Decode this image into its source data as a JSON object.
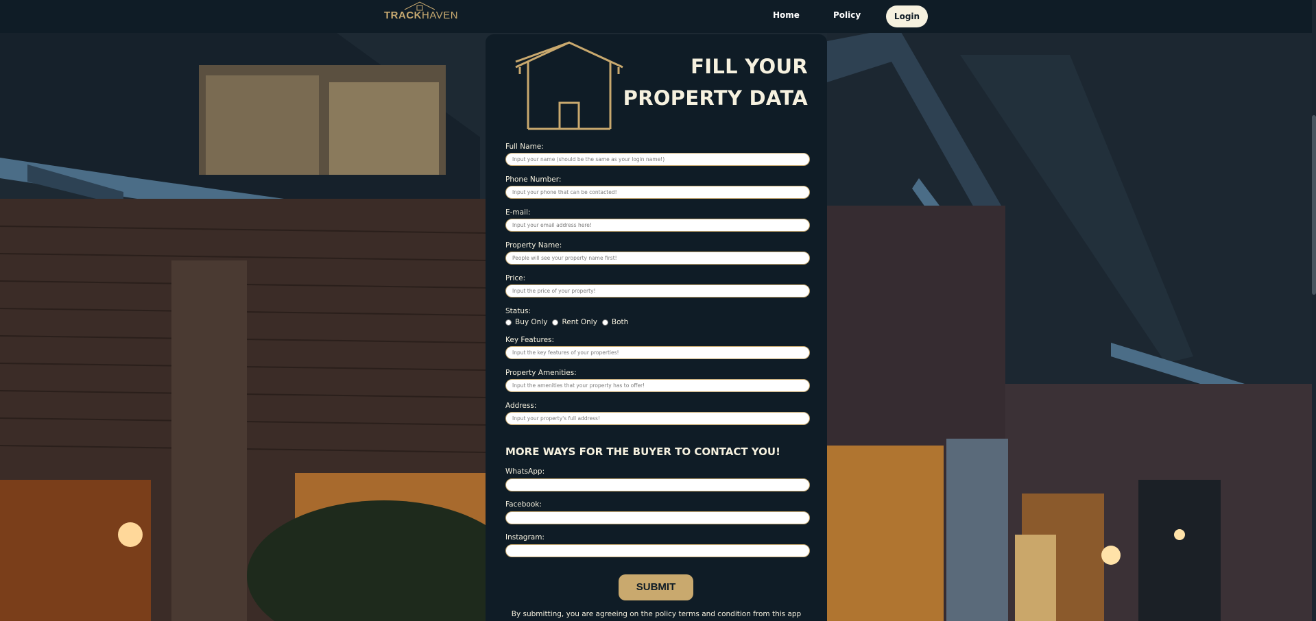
{
  "navbar": {
    "logo_main_light": "TRACK",
    "logo_main_bold": "HAVEN",
    "home": "Home",
    "policy": "Policy",
    "login": "Login"
  },
  "form": {
    "title_line1": "FILL YOUR",
    "title_line2": "PROPERTY DATA",
    "fields": {
      "full_name": {
        "label": "Full Name:",
        "placeholder": "Input your name (should be the same as your login name!)"
      },
      "phone": {
        "label": "Phone Number:",
        "placeholder": "Input your phone that can be contacted!"
      },
      "email": {
        "label": "E-mail:",
        "placeholder": "Input your email address here!"
      },
      "property_name": {
        "label": "Property Name:",
        "placeholder": "People will see your property name first!"
      },
      "price": {
        "label": "Price:",
        "placeholder": "Input the price of your property!"
      },
      "key_features": {
        "label": "Key Features:",
        "placeholder": "Input the key features of your properties!"
      },
      "amenities": {
        "label": "Property Amenities:",
        "placeholder": "Input the amenities that your property has to offer!"
      },
      "address": {
        "label": "Address:",
        "placeholder": "Input your property's full address!"
      }
    },
    "status": {
      "label": "Status:",
      "options": [
        "Buy Only",
        "Rent Only",
        "Both"
      ]
    },
    "contact_heading": "MORE WAYS FOR THE BUYER TO CONTACT YOU!",
    "contact_fields": {
      "whatsapp": {
        "label": "WhatsApp:"
      },
      "facebook": {
        "label": "Facebook:"
      },
      "instagram": {
        "label": "Instagram:"
      }
    },
    "submit": "SUBMIT",
    "disclaimer": "By submitting, you are agreeing on the policy terms and condition from this app"
  },
  "colors": {
    "navy": "#0f1c26",
    "gold": "#c9a96e",
    "cream": "#f6f1df"
  }
}
